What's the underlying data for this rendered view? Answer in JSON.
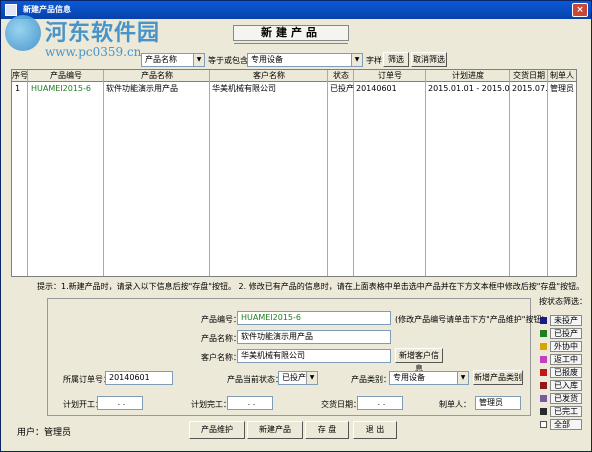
{
  "window": {
    "title": "新建产品信息",
    "close_glyph": "×"
  },
  "watermark": {
    "line1": "河东软件园",
    "line2": "www.pc0359.cn"
  },
  "panel_title": "新建产品",
  "filter": {
    "field_value": "产品名称",
    "operator_label": "等于或包含",
    "keyword_value": "专用设备",
    "mode_label": "字样",
    "filter_button": "筛选",
    "cancel_filter_button": "取消筛选"
  },
  "table": {
    "columns": [
      "序号",
      "产品编号",
      "产品名称",
      "客户名称",
      "状态",
      "订单号",
      "计划进度",
      "交货日期",
      "制单人"
    ],
    "rows": [
      {
        "no": "1",
        "code": "HUAMEI2015-6",
        "name": "软件功能演示用产品",
        "customer": "华美机械有限公司",
        "status": "已投产",
        "order": "20140601",
        "schedule": "2015.01.01 - 2015.06.09",
        "delivery": "2015.07.08",
        "creator": "管理员"
      }
    ]
  },
  "note": "提示：1.新建产品时，请录入以下信息后按\"存盘\"按钮。  2. 修改已有产品的信息时，请在上面表格中单击选中产品并在下方文本框中修改后按\"存盘\"按钮。",
  "form": {
    "code_label": "产品编号：",
    "code_value": "HUAMEI2015-6",
    "code_hint": "(修改产品编号请单击下方\"产品维护\"按钮)",
    "name_label": "产品名称：",
    "name_value": "软件功能演示用产品",
    "customer_label": "客户名称：",
    "customer_value": "华美机械有限公司",
    "new_customer_button": "新增客户信息",
    "order_label": "所属订单号：",
    "order_value": "20140601",
    "status_label": "产品当前状态：",
    "status_value": "已投产",
    "category_label": "产品类别：",
    "category_value": "专用设备",
    "new_category_button": "新增产品类别",
    "plan_start_label": "计划开工：",
    "plan_start_value": ". .",
    "plan_end_label": "计划完工：",
    "plan_end_value": ". .",
    "delivery_label": "交货日期：",
    "delivery_value": ". .",
    "creator_label": "制单人：",
    "creator_value": "管理员"
  },
  "status_filter": {
    "title": "按状态筛选：",
    "items": [
      {
        "label": "未投产",
        "color": "#1a1a8c"
      },
      {
        "label": "已投产",
        "color": "#1f7f1f"
      },
      {
        "label": "外协中",
        "color": "#d9a400"
      },
      {
        "label": "返工中",
        "color": "#c040c0"
      },
      {
        "label": "已报废",
        "color": "#c01818"
      },
      {
        "label": "已入库",
        "color": "#8c1a1a"
      },
      {
        "label": "已发货",
        "color": "#7a5aa0"
      },
      {
        "label": "已完工",
        "color": "#2a2a2a"
      },
      {
        "label": "全部",
        "color": "#ffffff"
      }
    ]
  },
  "user": {
    "label": "用户：管理员"
  },
  "actions": {
    "maintain": "产品维护",
    "new": "新建产品",
    "save": "存 盘",
    "exit": "退 出"
  }
}
